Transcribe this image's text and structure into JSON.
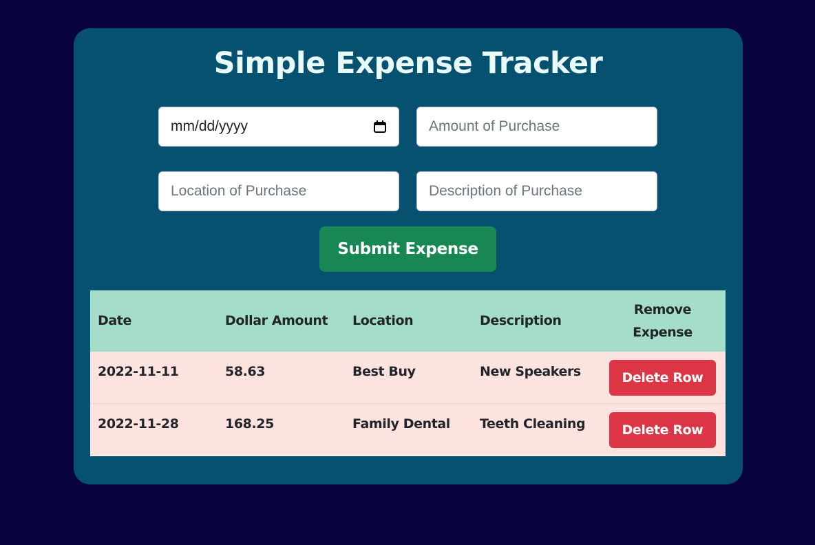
{
  "app": {
    "title": "Simple Expense Tracker"
  },
  "form": {
    "date_placeholder": "mm/dd/yyyy",
    "amount_placeholder": "Amount of Purchase",
    "location_placeholder": "Location of Purchase",
    "description_placeholder": "Description of Purchase",
    "submit_label": "Submit Expense"
  },
  "table": {
    "headers": [
      "Date",
      "Dollar Amount",
      "Location",
      "Description",
      "Remove Expense"
    ],
    "rows": [
      {
        "date": "2022-11-11",
        "amount": "58.63",
        "location": "Best Buy",
        "description": "New Speakers",
        "action_label": "Delete Row"
      },
      {
        "date": "2022-11-28",
        "amount": "168.25",
        "location": "Family Dental",
        "description": "Teeth Cleaning",
        "action_label": "Delete Row"
      }
    ]
  },
  "colors": {
    "page_background": "#08023e",
    "card_background": "#05516f",
    "submit_button": "#198754",
    "delete_button": "#dc3545",
    "table_header": "#a5ddcb",
    "table_body": "#fde3e0"
  },
  "icons": {
    "date_picker": "calendar-icon"
  }
}
